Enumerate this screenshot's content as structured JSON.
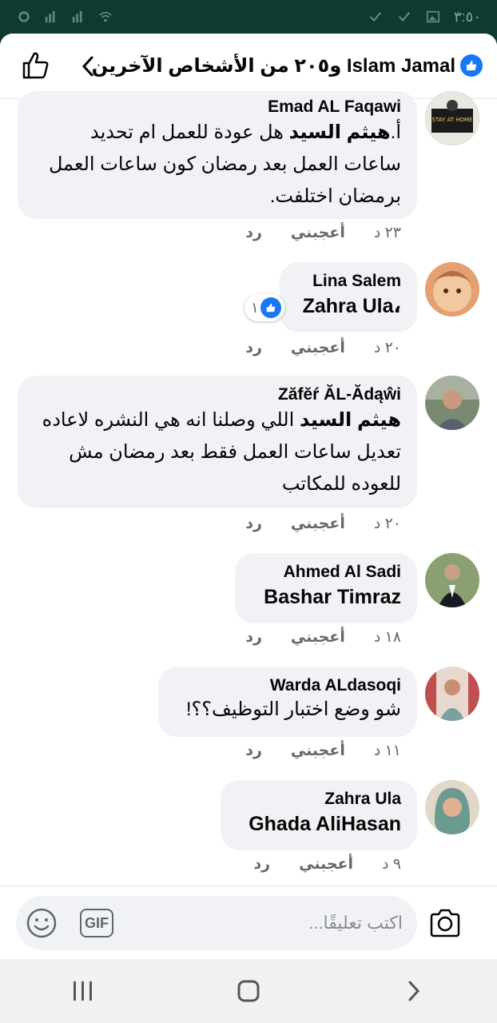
{
  "status_bar": {
    "time": "٣:٥٠"
  },
  "header": {
    "title": "Islam Jamal و٢٠٥ من الأشخاص الآخرين"
  },
  "comments": [
    {
      "author": "Emad AL Faqawi",
      "prefix": "أ.",
      "mention": "هيثم السيد",
      "text": " هل عودة للعمل ام تحديد ساعات العمل بعد رمضان كون ساعات العمل برمضان اختلفت.",
      "time": "٢٣ د",
      "like": "أعجبني",
      "reply": "رد"
    },
    {
      "author": "Lina Salem",
      "tag": "Zahra Ula",
      "comma": "،",
      "reaction_count": "١",
      "time": "٢٠ د",
      "like": "أعجبني",
      "reply": "رد"
    },
    {
      "author": "Zăfĕŕ ĂL-Ădąŵi",
      "mention": "هيثم السيد",
      "text": " اللي وصلنا انه هي النشره لاعاده تعديل ساعات العمل فقط بعد رمضان مش للعوده للمكاتب",
      "time": "٢٠ د",
      "like": "أعجبني",
      "reply": "رد"
    },
    {
      "author": "Ahmed Al Sadi",
      "tag": "Bashar Timraz",
      "time": "١٨ د",
      "like": "أعجبني",
      "reply": "رد"
    },
    {
      "author": "Warda ALdasoqi",
      "text": "شو وضع اختبار التوظيف؟؟!",
      "time": "١١ د",
      "like": "أعجبني",
      "reply": "رد"
    },
    {
      "author": "Zahra Ula",
      "tag": "Ghada AliHasan",
      "time": "٩ د",
      "like": "أعجبني",
      "reply": "رد"
    }
  ],
  "composer": {
    "placeholder": "اكتب تعليقًا...",
    "gif_label": "GIF"
  },
  "colors": {
    "status_bar_bg": "#0d3b2f",
    "bubble_bg": "#f0f2f5",
    "accent_blue": "#1877f2",
    "meta_text": "#65676b"
  },
  "icons": {
    "header_like": "thumbs-up-outline-icon",
    "back": "chevron-right-icon",
    "like_badge": "thumbs-up-filled-icon",
    "emoji": "smiley-icon",
    "gif": "gif-icon",
    "camera": "camera-icon",
    "nav_recent": "recent-apps-icon",
    "nav_home": "home-icon",
    "nav_back": "back-icon"
  }
}
